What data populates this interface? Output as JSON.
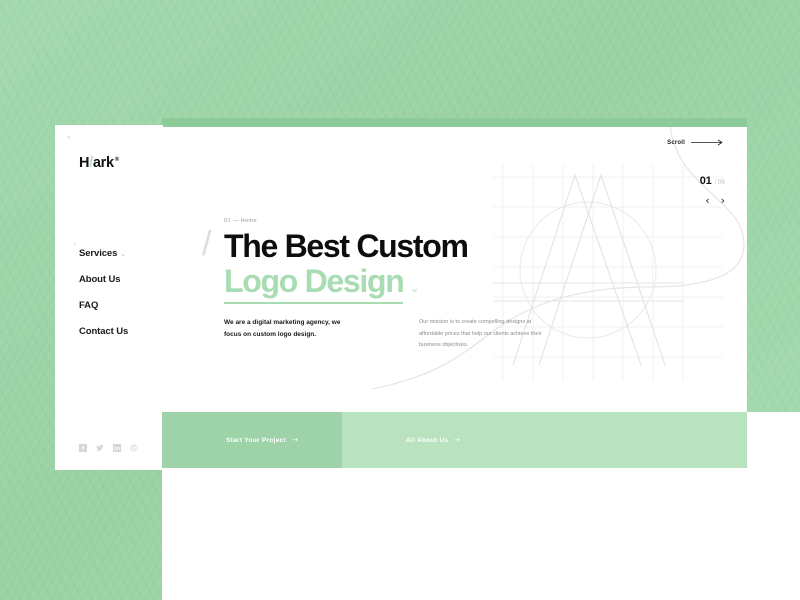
{
  "brand": {
    "logo_first": "H",
    "logo_slash": "/",
    "logo_rest": "ark",
    "registered_mark": "®",
    "corner_mark": "«"
  },
  "sidebar": {
    "quote_mark": "“",
    "nav_items": [
      {
        "label": "Services",
        "has_chevron": true,
        "chevron": "⌄"
      },
      {
        "label": "About Us",
        "has_chevron": false,
        "chevron": ""
      },
      {
        "label": "FAQ",
        "has_chevron": false,
        "chevron": ""
      },
      {
        "label": "Contact Us",
        "has_chevron": false,
        "chevron": ""
      }
    ],
    "social": [
      {
        "name": "facebook-icon",
        "label": "Facebook"
      },
      {
        "name": "twitter-icon",
        "label": "Twitter"
      },
      {
        "name": "linkedin-icon",
        "label": "LinkedIn"
      },
      {
        "name": "dribbble-icon",
        "label": "Dribbble"
      }
    ]
  },
  "hero": {
    "eyebrow": "01 — Home",
    "slash": "/",
    "headline_line1": "The Best Custom",
    "headline_line2": "Logo Design",
    "headline_chevron": "⌄",
    "copy_primary": "We are a digital marketing agency, we focus on custom logo design.",
    "copy_secondary": "Our mission is to create compelling designs at affordable prices that help our clients achieve their business objectives."
  },
  "scroll": {
    "label": "Scroll",
    "arrow_name": "arrow-right-icon"
  },
  "slider": {
    "current": "01",
    "separator": "/",
    "total": "06",
    "prev": "‹",
    "next": "›"
  },
  "cta": [
    {
      "label": "Start Your Project",
      "arrow": "→"
    },
    {
      "label": "All About Us",
      "arrow": "→"
    }
  ],
  "colors": {
    "background_green": "#9ed6a9",
    "accent_green": "#a8dcb2",
    "cta_primary_green": "#9ed2a9",
    "cta_secondary_green": "#b9e2c1",
    "card_white": "#ffffff",
    "text_black": "#0d0d0d",
    "text_muted": "#8c8c8c"
  }
}
